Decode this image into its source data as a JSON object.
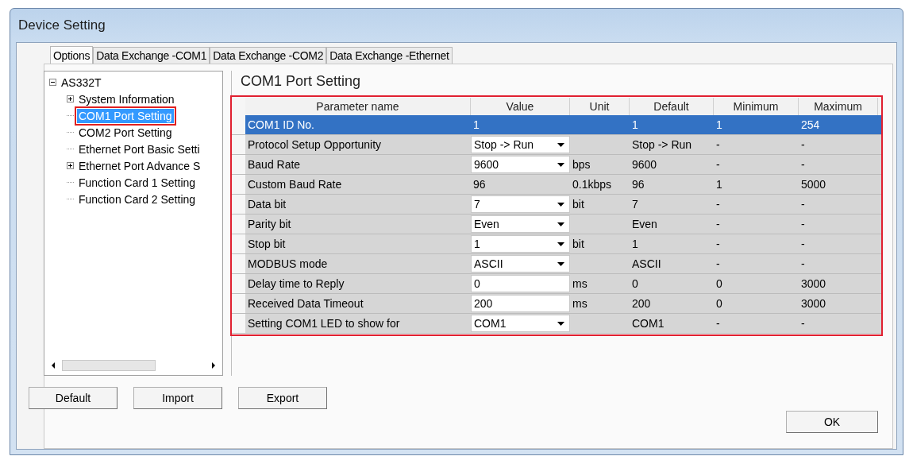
{
  "window": {
    "title": "Device Setting"
  },
  "tabs": [
    {
      "label": "Options",
      "selected": true
    },
    {
      "label": "Data Exchange -COM1",
      "selected": false
    },
    {
      "label": "Data Exchange -COM2",
      "selected": false
    },
    {
      "label": "Data Exchange -Ethernet",
      "selected": false
    }
  ],
  "tree": [
    {
      "label": "AS332T",
      "expanded": true,
      "selected": false,
      "children": [
        {
          "label": "System Information",
          "expanded": false,
          "selected": false
        },
        {
          "label": "COM1 Port Setting",
          "selected": true
        },
        {
          "label": "COM2 Port Setting",
          "selected": false
        },
        {
          "label": "Ethernet Port Basic Setti",
          "selected": false
        },
        {
          "label": "Ethernet Port Advance S",
          "expanded": false,
          "selected": false
        },
        {
          "label": "Function Card 1 Setting",
          "selected": false
        },
        {
          "label": "Function Card 2 Setting",
          "selected": false
        }
      ]
    }
  ],
  "panel": {
    "title": "COM1 Port Setting"
  },
  "table": {
    "columns": [
      "Parameter name",
      "Value",
      "Unit",
      "Default",
      "Minimum",
      "Maximum"
    ],
    "rows": [
      {
        "name": "COM1 ID No.",
        "value": "1",
        "kind": "readonly",
        "default": "1",
        "minimum": "1",
        "maximum": "254",
        "selected": true
      },
      {
        "name": "Protocol Setup Opportunity",
        "value": "Stop -> Run",
        "kind": "dropdown",
        "default": "Stop -> Run",
        "minimum": "-",
        "maximum": "-",
        "selected": false
      },
      {
        "name": "Baud Rate",
        "value": "9600",
        "kind": "dropdown",
        "unit": "bps",
        "default": "9600",
        "minimum": "-",
        "maximum": "-",
        "selected": false
      },
      {
        "name": "Custom Baud Rate",
        "value": "96",
        "kind": "readonly",
        "unit": "0.1kbps",
        "default": "96",
        "minimum": "1",
        "maximum": "5000",
        "selected": false
      },
      {
        "name": "Data bit",
        "value": "7",
        "kind": "dropdown",
        "unit": "bit",
        "default": "7",
        "minimum": "-",
        "maximum": "-",
        "selected": false
      },
      {
        "name": "Parity bit",
        "value": "Even",
        "kind": "dropdown",
        "default": "Even",
        "minimum": "-",
        "maximum": "-",
        "selected": false
      },
      {
        "name": "Stop bit",
        "value": "1",
        "kind": "dropdown",
        "unit": "bit",
        "default": "1",
        "minimum": "-",
        "maximum": "-",
        "selected": false
      },
      {
        "name": "MODBUS mode",
        "value": "ASCII",
        "kind": "dropdown",
        "default": "ASCII",
        "minimum": "-",
        "maximum": "-",
        "selected": false
      },
      {
        "name": "Delay time to Reply",
        "value": "0",
        "kind": "input",
        "unit": "ms",
        "default": "0",
        "minimum": "0",
        "maximum": "3000",
        "selected": false
      },
      {
        "name": "Received Data Timeout",
        "value": "200",
        "kind": "input",
        "unit": "ms",
        "default": "200",
        "minimum": "0",
        "maximum": "3000",
        "selected": false
      },
      {
        "name": "Setting COM1 LED to show for",
        "value": "COM1",
        "kind": "dropdown",
        "default": "COM1",
        "minimum": "-",
        "maximum": "-",
        "selected": false
      }
    ]
  },
  "buttons": [
    "Default",
    "Import",
    "Export"
  ],
  "ok_button": "OK"
}
